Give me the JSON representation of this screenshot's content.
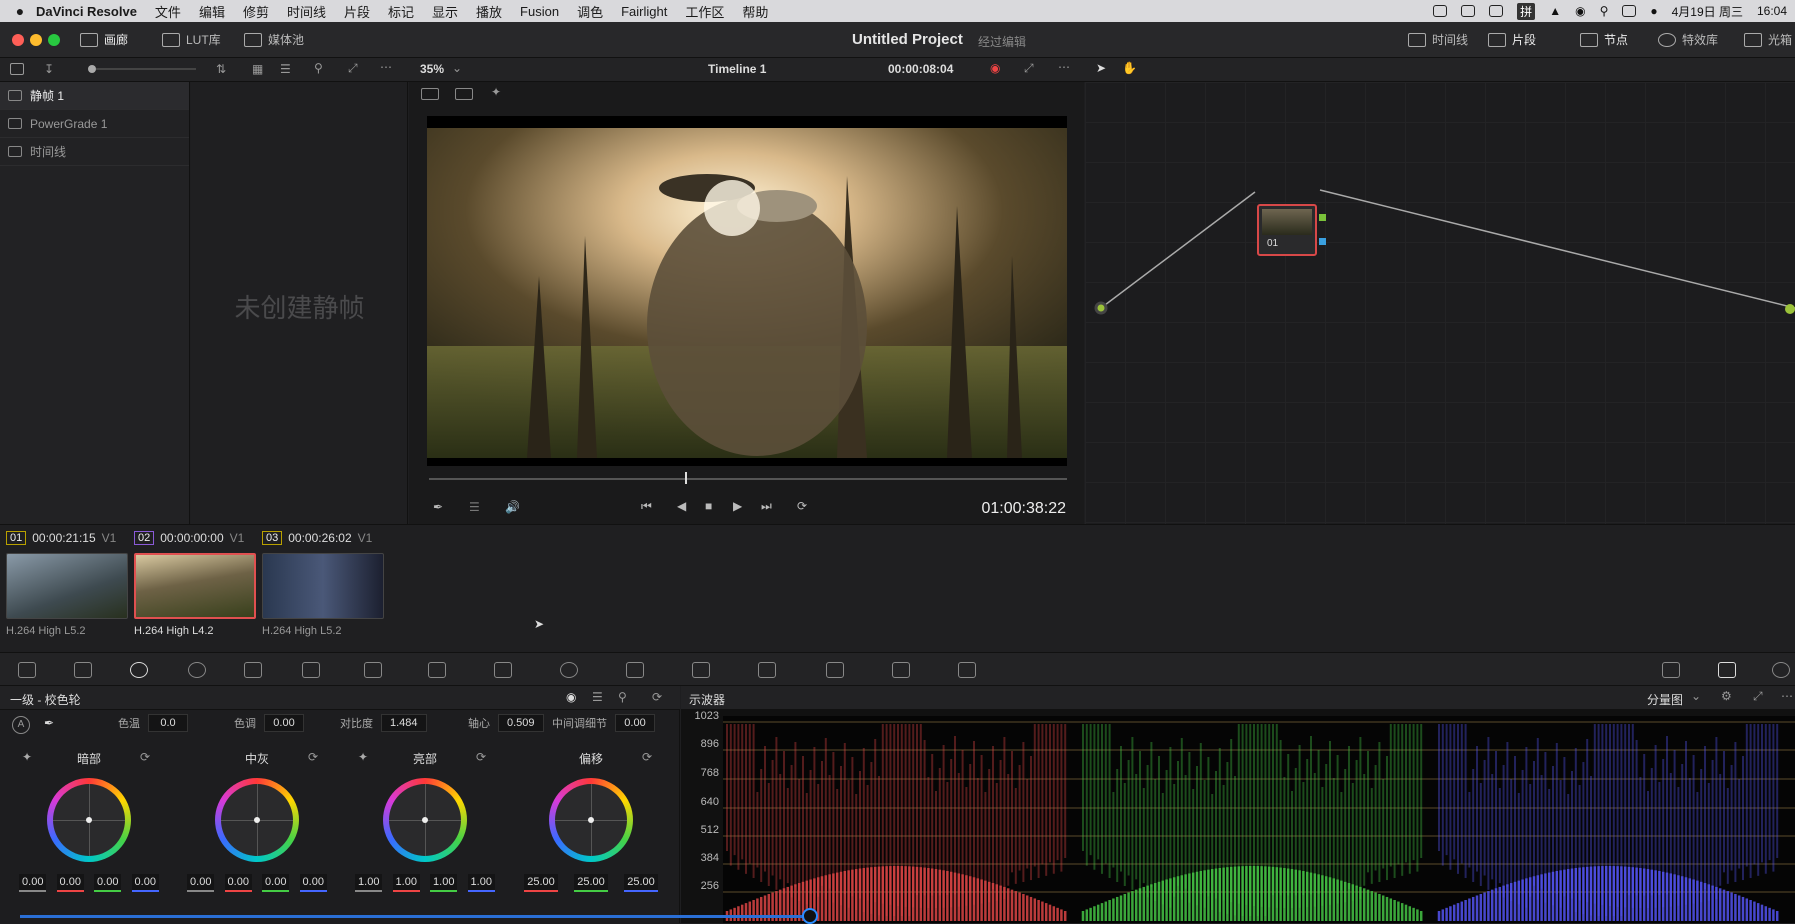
{
  "menubar": {
    "app": "DaVinci Resolve",
    "items": [
      "文件",
      "编辑",
      "修剪",
      "时间线",
      "片段",
      "标记",
      "显示",
      "播放",
      "Fusion",
      "调色",
      "Fairlight",
      "工作区",
      "帮助"
    ],
    "date": "4月19日 周三",
    "time": "16:04",
    "ime": "拼"
  },
  "titlebar": {
    "gallery": "画廊",
    "lut": "LUT库",
    "mediapool": "媒体池",
    "project": "Untitled Project",
    "status": "经过编辑",
    "timeline": "时间线",
    "clips": "片段",
    "nodes": "节点",
    "effects": "特效库",
    "lightbox": "光箱"
  },
  "viewer": {
    "zoom": "35%",
    "timeline_name": "Timeline 1",
    "duration": "00:00:08:04",
    "timecode": "01:00:38:22"
  },
  "gallery": {
    "albums": [
      "静帧 1",
      "PowerGrade 1",
      "时间线"
    ],
    "empty_text": "未创建静帧"
  },
  "node": {
    "label": "01"
  },
  "clips": [
    {
      "num": "01",
      "tc": "00:00:21:15",
      "track": "V1",
      "codec": "H.264 High L5.2"
    },
    {
      "num": "02",
      "tc": "00:00:00:00",
      "track": "V1",
      "codec": "H.264 High L4.2"
    },
    {
      "num": "03",
      "tc": "00:00:26:02",
      "track": "V1",
      "codec": "H.264 High L5.2"
    }
  ],
  "color": {
    "panel_title": "一级 - 校色轮",
    "params": [
      {
        "label": "色温",
        "value": "0.0"
      },
      {
        "label": "色调",
        "value": "0.00"
      },
      {
        "label": "对比度",
        "value": "1.484"
      },
      {
        "label": "轴心",
        "value": "0.509"
      },
      {
        "label": "中间调细节",
        "value": "0.00"
      }
    ],
    "wheels": [
      {
        "name": "暗部",
        "values": [
          "0.00",
          "0.00",
          "0.00",
          "0.00"
        ]
      },
      {
        "name": "中灰",
        "values": [
          "0.00",
          "0.00",
          "0.00",
          "0.00"
        ]
      },
      {
        "name": "亮部",
        "values": [
          "1.00",
          "1.00",
          "1.00",
          "1.00"
        ]
      },
      {
        "name": "偏移",
        "values": [
          "25.00",
          "25.00",
          "25.00"
        ]
      }
    ]
  },
  "scope": {
    "title": "示波器",
    "mode": "分量图",
    "ylabels": [
      "1023",
      "896",
      "768",
      "640",
      "512",
      "384",
      "256"
    ],
    "channel_colors": [
      "#e84848",
      "#48d048",
      "#5858ff"
    ]
  }
}
